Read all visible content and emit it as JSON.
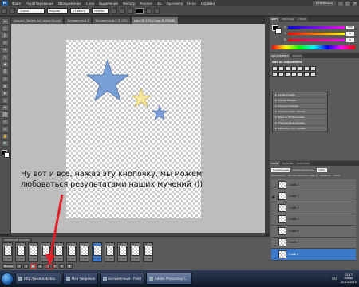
{
  "app": {
    "logo": "Ps",
    "menu": [
      "Файл",
      "Редактирование",
      "Изображение",
      "Слои",
      "Выделение",
      "Фильтр",
      "Анализ",
      "3D",
      "Просмотр",
      "Окно",
      "Справка"
    ],
    "workspace": "ESSENTIALS",
    "window_controls": [
      "–",
      "□",
      "×"
    ]
  },
  "options_bar": {
    "font_family": "Calibri",
    "font_style": "Regular",
    "font_size": "27,88 пт",
    "antialias": "Резкое"
  },
  "doc_tabs": [
    {
      "label": "Lessons_Tablets_w4_lesson34.psd",
      "active": false
    },
    {
      "label": "Безымянный-1",
      "active": false
    },
    {
      "label": "Безымянный-2 @ 25%",
      "active": false
    },
    {
      "label": "Land @ 25% (Слой 8, RGB/8)",
      "active": true
    }
  ],
  "tools": [
    "▸",
    "⬚",
    "ʘ",
    "✄",
    "⌖",
    "✎",
    "✚",
    "⎘",
    "⊘",
    "▦",
    "◐",
    "◬",
    "✒",
    "T",
    "↖",
    "▭",
    "✋",
    "🔍"
  ],
  "color_panel": {
    "tabs": [
      "ЦВЕТ",
      "ОБРАЗЦЫ",
      "СТИЛИ"
    ],
    "channels": [
      {
        "label": "R",
        "value": "255",
        "gradient": "linear-gradient(to right, #00f, #f0f)"
      },
      {
        "label": "G",
        "value": "0",
        "gradient": "linear-gradient(to right, #f00, #ff0)"
      },
      {
        "label": "B",
        "value": "0",
        "gradient": "linear-gradient(to right, #f00, #f0f)"
      }
    ]
  },
  "adjustments_panel": {
    "tabs": [
      "ADJUSTMENTS",
      "МАСКИ"
    ],
    "heading": "Add an adjustment",
    "icon_count": 14,
    "presets": [
      "Levels Presets",
      "Curves Presets",
      "Exposure Presets",
      "Hue/Saturation Presets",
      "Black & White Presets",
      "Channel Mixer Presets",
      "Selective Color Presets"
    ]
  },
  "layers_panel": {
    "tabs": [
      "СЛОИ",
      "КАНАЛЫ",
      "КОНТУРЫ"
    ],
    "blend_mode": "Нормальный",
    "opacity_label": "Непрозрачность:",
    "opacity_value": "100%",
    "lock_label": "Закрепить:",
    "fill_label": "Заливка:",
    "fill_value": "100%",
    "propagate_label": "Распространить кадр 1",
    "layers": [
      {
        "name": "Слой 2",
        "visible": false,
        "selected": false
      },
      {
        "name": "Слой 3",
        "visible": true,
        "selected": false
      },
      {
        "name": "Слой 4",
        "visible": false,
        "selected": false
      },
      {
        "name": "Слой 5",
        "visible": false,
        "selected": false
      },
      {
        "name": "Слой 6",
        "visible": false,
        "selected": false
      },
      {
        "name": "Слой 7",
        "visible": false,
        "selected": false
      },
      {
        "name": "Слой 8",
        "visible": false,
        "selected": true
      }
    ]
  },
  "annotation": {
    "line1": "Ну вот и все, нажав эту кнопочку, мы можем",
    "line2": "любоваться результатами наших мучений )))"
  },
  "animation_panel": {
    "title": "АНИМАЦИЯ (КАДРЫ)",
    "frames": [
      {
        "num": "1",
        "delay": "0,5 сек.▾",
        "selected": false
      },
      {
        "num": "2",
        "delay": "0,5 сек.▾",
        "selected": false
      },
      {
        "num": "3",
        "delay": "0,5 сек.▾",
        "selected": false
      },
      {
        "num": "4",
        "delay": "0,5 сек.▾",
        "selected": false
      },
      {
        "num": "5",
        "delay": "0,5 сек.▾",
        "selected": false
      },
      {
        "num": "6",
        "delay": "0,5 сек.▾",
        "selected": false
      },
      {
        "num": "7",
        "delay": "0,5 сек.▾",
        "selected": false
      },
      {
        "num": "8",
        "delay": "0,5 сек.▾",
        "selected": true
      },
      {
        "num": "9",
        "delay": "0,5 сек.▾",
        "selected": false
      },
      {
        "num": "10",
        "delay": "0,5 сек.▾",
        "selected": false
      },
      {
        "num": "11",
        "delay": "0,5 сек.▾",
        "selected": false
      },
      {
        "num": "12",
        "delay": "0,5 сек.▾",
        "selected": false
      }
    ],
    "loop_label": "Всегда",
    "controls": [
      "|◂",
      "◂",
      "▶",
      "▸",
      "▸|",
      "⧉",
      "⊕",
      "🗑"
    ],
    "play_tooltip": "Запуск"
  },
  "taskbar": {
    "items": [
      {
        "label": "http://www.babyblo...",
        "icon": "browser-icon",
        "active": false
      },
      {
        "label": "Мои творения",
        "icon": "folder-icon",
        "active": false
      },
      {
        "label": "Безымянный - Paint",
        "icon": "paint-icon",
        "active": false
      },
      {
        "label": "Adobe Photoshop C...",
        "icon": "photoshop-icon",
        "active": true
      }
    ],
    "language": "RU",
    "time": "12:17",
    "weekday": "среда",
    "date": "20.10.2010"
  },
  "colors": {
    "star_large": "#7a9fd6",
    "star_small_blue": "#7a9fd6",
    "star_yellow": "#f3e69b",
    "arrow": "#e0202a",
    "selection": "#3b78c8"
  }
}
